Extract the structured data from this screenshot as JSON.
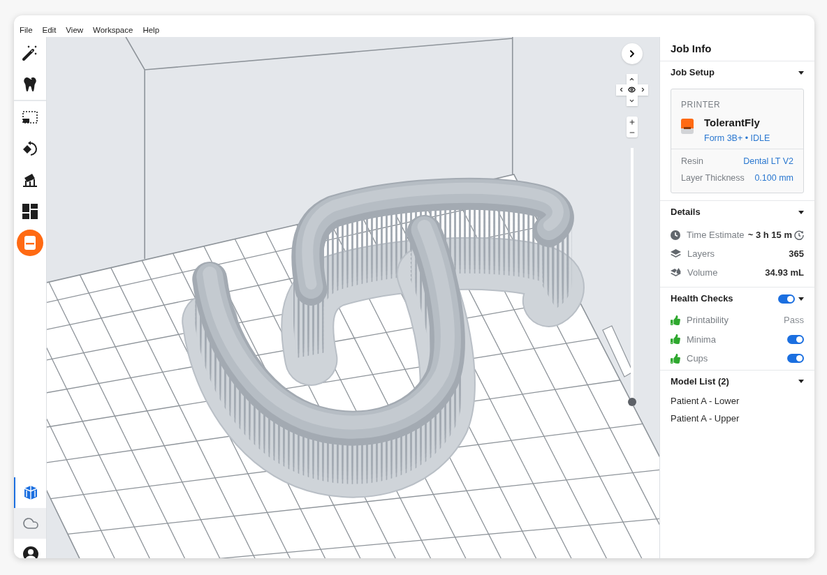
{
  "menu": [
    {
      "label": "File"
    },
    {
      "label": "Edit"
    },
    {
      "label": "View"
    },
    {
      "label": "Workspace"
    },
    {
      "label": "Help"
    }
  ],
  "toolbar": {
    "groups": [
      {
        "items": [
          {
            "kind": "wand",
            "selected": false
          },
          {
            "kind": "tooth",
            "selected": false
          }
        ]
      },
      {
        "items": [
          {
            "kind": "select",
            "selected": false
          },
          {
            "kind": "orient",
            "selected": false
          },
          {
            "kind": "supports",
            "selected": false
          },
          {
            "kind": "layout",
            "selected": false
          },
          {
            "kind": "job",
            "selected": true
          }
        ]
      }
    ],
    "bottom": [
      {
        "kind": "volume",
        "selected": true,
        "hovered": false
      },
      {
        "kind": "cloud",
        "selected": false,
        "hovered": true
      },
      {
        "kind": "account",
        "selected": false,
        "hovered": false
      }
    ]
  },
  "viewport": {
    "layer_slider": {
      "level": 0
    }
  },
  "panel": {
    "title": "Job Info",
    "job_setup": {
      "title": "Job Setup",
      "expanded": true,
      "printer": {
        "label": "PRINTER",
        "name": "TolerantFly",
        "model_status": "Form 3B+ • IDLE"
      },
      "settings": [
        {
          "label": "Resin",
          "value": "Dental LT V2"
        },
        {
          "label": "Layer Thickness",
          "value": "0.100 mm"
        }
      ]
    },
    "details": {
      "title": "Details",
      "expanded": true,
      "rows": [
        {
          "kind": "time",
          "label": "Time Estimate",
          "value": "~ 3 h 15 m"
        },
        {
          "kind": "layers",
          "label": "Layers",
          "value": "365"
        },
        {
          "kind": "volume",
          "label": "Volume",
          "value": "34.93 mL"
        }
      ]
    },
    "health_checks": {
      "title": "Health Checks",
      "on": true,
      "expanded": true,
      "checks": [
        {
          "kind": "status",
          "label": "Printability",
          "value": "Pass"
        },
        {
          "kind": "toggle",
          "label": "Minima",
          "on": true
        },
        {
          "kind": "toggle",
          "label": "Cups",
          "on": true
        }
      ]
    },
    "model_list": {
      "title": "Model List (2)",
      "expanded": true,
      "models": [
        {
          "name": "Patient A - Lower",
          "selected": false
        },
        {
          "name": "Patient A - Upper",
          "selected": false
        }
      ]
    }
  }
}
